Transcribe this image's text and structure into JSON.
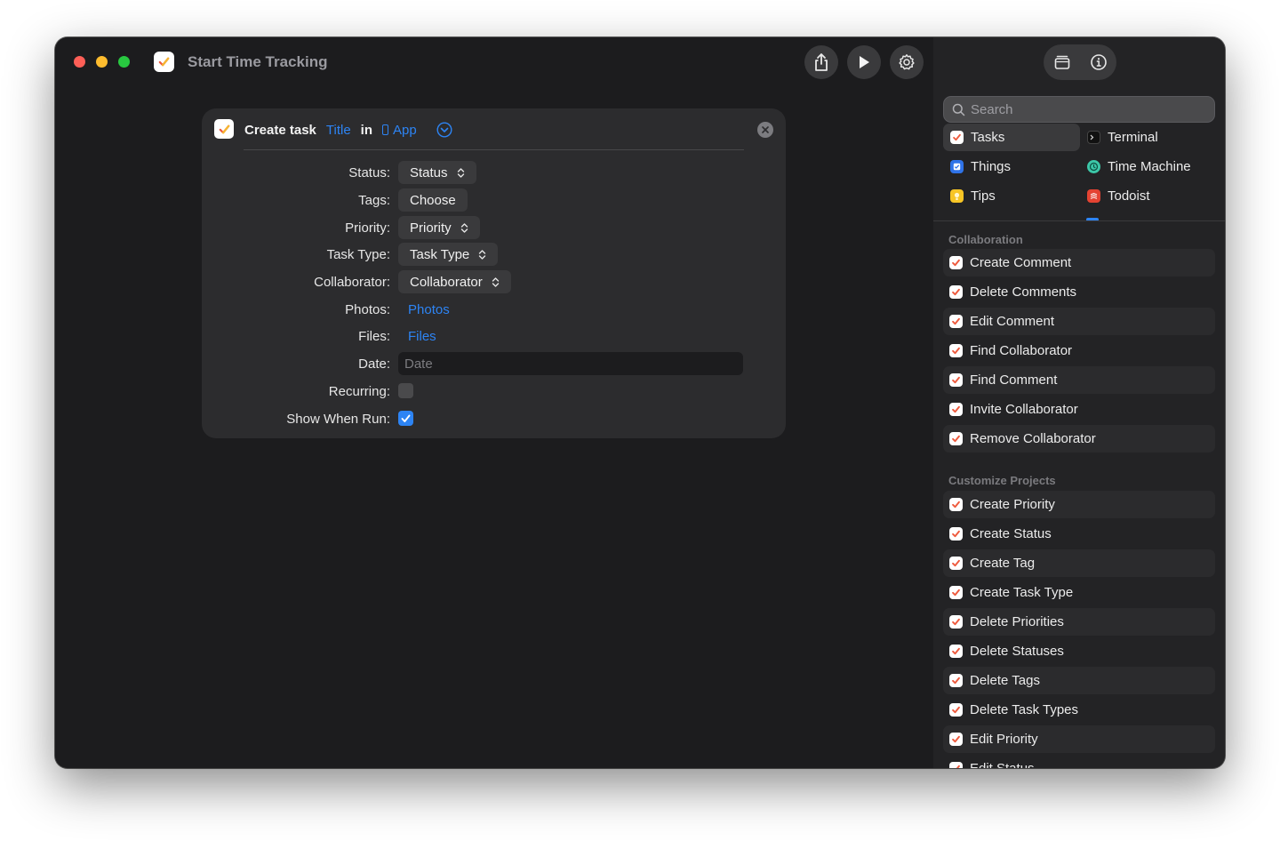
{
  "window": {
    "title": "Start Time Tracking",
    "icons": {
      "close": "close-traffic-light",
      "minimize": "minimize-traffic-light",
      "zoom": "zoom-traffic-light",
      "app": "tasks-app-icon"
    },
    "toolbar": {
      "share_icon": "share-icon",
      "run_icon": "play-icon",
      "settings_icon": "gear-icon"
    }
  },
  "action": {
    "verb": "Create task",
    "title_token": "Title",
    "in_word": "in",
    "app_token": "App",
    "params": [
      {
        "label": "Status:",
        "type": "popup",
        "value": "Status"
      },
      {
        "label": "Tags:",
        "type": "button",
        "value": "Choose"
      },
      {
        "label": "Priority:",
        "type": "popup",
        "value": "Priority"
      },
      {
        "label": "Task Type:",
        "type": "popup",
        "value": "Task Type"
      },
      {
        "label": "Collaborator:",
        "type": "popup",
        "value": "Collaborator"
      },
      {
        "label": "Photos:",
        "type": "link",
        "value": "Photos"
      },
      {
        "label": "Files:",
        "type": "link",
        "value": "Files"
      },
      {
        "label": "Date:",
        "type": "field",
        "placeholder": "Date"
      },
      {
        "label": "Recurring:",
        "type": "checkbox",
        "checked": false
      },
      {
        "label": "Show When Run:",
        "type": "checkbox",
        "checked": true
      }
    ]
  },
  "sidebar": {
    "tabs": {
      "library_icon": "library-icon",
      "info_icon": "info-icon"
    },
    "search": {
      "placeholder": "Search",
      "value": ""
    },
    "apps": [
      {
        "name": "Tasks",
        "icon": "tasks-icon",
        "color": "#ffffff",
        "selected": true
      },
      {
        "name": "Terminal",
        "icon": "terminal-icon",
        "color": "#111111",
        "selected": false
      },
      {
        "name": "Things",
        "icon": "things-icon",
        "color": "#2f73e8",
        "selected": false
      },
      {
        "name": "Time Machine",
        "icon": "time-machine-icon",
        "color": "#3cc7a8",
        "selected": false
      },
      {
        "name": "Tips",
        "icon": "tips-icon",
        "color": "#f7c525",
        "selected": false
      },
      {
        "name": "Todoist",
        "icon": "todoist-icon",
        "color": "#e44332",
        "selected": false
      }
    ],
    "sections": [
      {
        "title": "Collaboration",
        "items": [
          "Create Comment",
          "Delete Comments",
          "Edit Comment",
          "Find Collaborator",
          "Find Comment",
          "Invite Collaborator",
          "Remove Collaborator"
        ]
      },
      {
        "title": "Customize Projects",
        "items": [
          "Create Priority",
          "Create Status",
          "Create Tag",
          "Create Task Type",
          "Delete Priorities",
          "Delete Statuses",
          "Delete Tags",
          "Delete Task Types",
          "Edit Priority",
          "Edit Status"
        ]
      }
    ]
  },
  "colors": {
    "accent": "#2d84f4",
    "window_bg": "#1c1c1e",
    "card_bg": "#2c2c2e",
    "sidebar_bg": "#232325"
  }
}
